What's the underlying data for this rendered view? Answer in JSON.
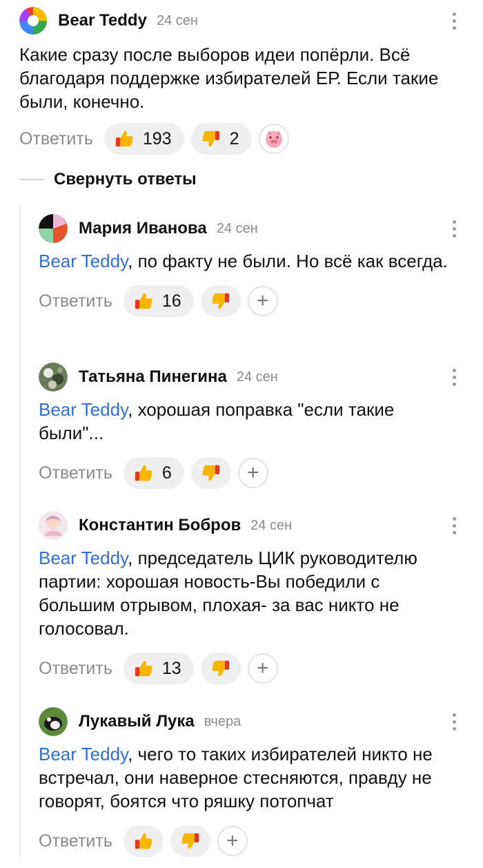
{
  "collapse_label": "Свернуть ответы",
  "reply_label": "Ответить",
  "comments": [
    {
      "author": "Bear Teddy",
      "time": "24 сен",
      "text": "Какие сразу после выборов идеи попёрли. Всё благодаря поддержке избирателей ЕР. Если такие были, конечно.",
      "likes": "193",
      "dislikes": "2",
      "extra_reaction": "pig-face-icon"
    },
    {
      "author": "Мария Иванова",
      "time": "24 сен",
      "mention": "Bear Teddy",
      "text": ", по факту не были. Но всё как всегда.",
      "likes": "16",
      "dislikes": ""
    },
    {
      "author": "Татьяна Пинегина",
      "time": "24 сен",
      "mention": "Bear Teddy",
      "text": ", хорошая поправка \"если такие были\"...",
      "likes": "6",
      "dislikes": ""
    },
    {
      "author": "Константин Бобров",
      "time": "24 сен",
      "mention": "Bear Teddy",
      "text": ", председатель ЦИК руководителю партии: хорошая новость-Вы победили с большим отрывом, плохая- за вас никто не голосовал.",
      "likes": "13",
      "dislikes": ""
    },
    {
      "author": "Лукавый Лука",
      "time": "вчера",
      "mention": "Bear Teddy",
      "text": ", чего то таких избирателей никто не встречал, они наверное стесняются, правду не говорят, боятся что ряшку потопчат",
      "likes": "",
      "dislikes": ""
    }
  ],
  "colors": {
    "mention": "#2f6fd6",
    "muted": "#8a8a8a",
    "pill_bg": "#efefef",
    "thumb_yellow": "#f7b500",
    "thumb_red": "#e3391f"
  }
}
